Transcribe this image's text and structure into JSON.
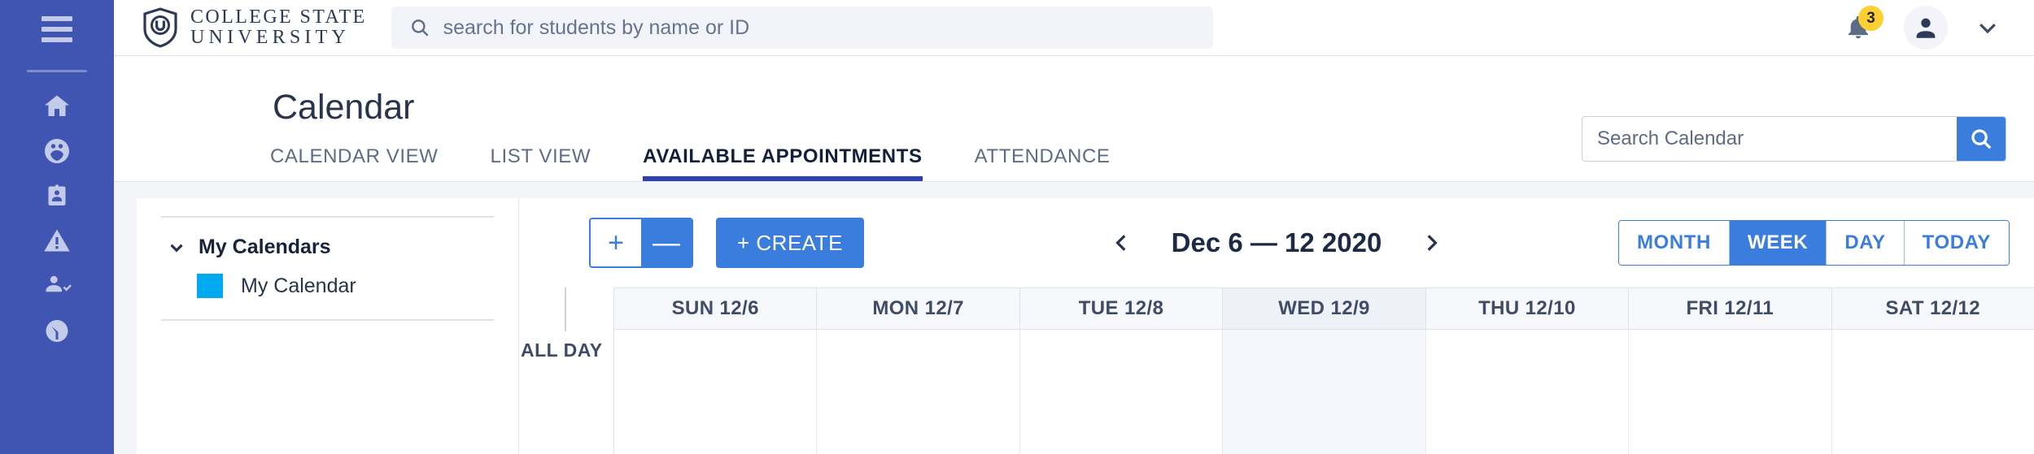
{
  "sidebar": {
    "menu_icon": "hamburger-icon",
    "items": [
      {
        "icon": "home-icon",
        "name": "home"
      },
      {
        "icon": "group-icon",
        "name": "students"
      },
      {
        "icon": "id-badge-icon",
        "name": "staff"
      },
      {
        "icon": "warning-triangle-icon",
        "name": "alerts"
      },
      {
        "icon": "person-check-icon",
        "name": "appointments"
      },
      {
        "icon": "gauge-icon",
        "name": "reports"
      }
    ]
  },
  "topbar": {
    "logo": {
      "line1": "COLLEGE STATE",
      "line2": "UNIVERSITY",
      "mark": "shield-u-icon"
    },
    "search": {
      "placeholder": "search for students by name or ID",
      "value": "",
      "icon": "search-icon"
    },
    "notifications": {
      "count": "3",
      "icon": "bell-icon",
      "badge_color": "#fdcf33"
    },
    "account": {
      "icon": "user-avatar-icon",
      "caret": "chevron-down-icon"
    }
  },
  "page": {
    "title": "Calendar",
    "tabs": [
      {
        "label": "CALENDAR VIEW",
        "active": false
      },
      {
        "label": "LIST VIEW",
        "active": false
      },
      {
        "label": "AVAILABLE APPOINTMENTS",
        "active": true
      },
      {
        "label": "ATTENDANCE",
        "active": false
      }
    ],
    "active_tab_color": "#2d3eb0",
    "calendar_search": {
      "placeholder": "Search Calendar",
      "value": "",
      "button_icon": "search-icon",
      "button_color": "#3b7ddd"
    }
  },
  "left_panel": {
    "group_label": "My Calendars",
    "group_toggle_icon": "chevron-down-icon",
    "calendars": [
      {
        "label": "My Calendar",
        "color": "#00aaf0"
      }
    ]
  },
  "toolbar": {
    "zoom_in_label": "+",
    "zoom_out_label": "—",
    "create_label": "+ CREATE",
    "prev_icon": "chevron-left-icon",
    "next_icon": "chevron-right-icon",
    "date_range": "Dec 6 — 12 2020",
    "views": [
      {
        "label": "MONTH",
        "active": false
      },
      {
        "label": "WEEK",
        "active": true
      },
      {
        "label": "DAY",
        "active": false
      },
      {
        "label": "TODAY",
        "active": false
      }
    ],
    "accent_color": "#3b7ddd"
  },
  "calendar_grid": {
    "allday_label": "ALL DAY",
    "days": [
      {
        "label": "SUN 12/6",
        "today": false
      },
      {
        "label": "MON 12/7",
        "today": false
      },
      {
        "label": "TUE 12/8",
        "today": false
      },
      {
        "label": "WED 12/9",
        "today": true
      },
      {
        "label": "THU 12/10",
        "today": false
      },
      {
        "label": "FRI 12/11",
        "today": false
      },
      {
        "label": "SAT 12/12",
        "today": false
      }
    ]
  }
}
